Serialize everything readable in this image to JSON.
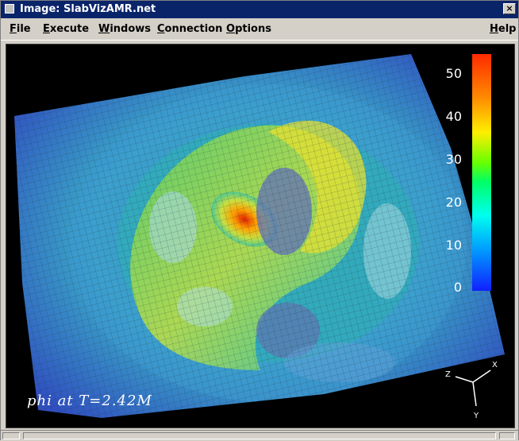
{
  "window": {
    "title": "Image: SlabVizAMR.net",
    "close_glyph": "×"
  },
  "menu": {
    "items": [
      {
        "label": "File",
        "mnemonic": "F",
        "rest": "ile"
      },
      {
        "label": "Execute",
        "mnemonic": "E",
        "rest": "xecute"
      },
      {
        "label": "Windows",
        "mnemonic": "W",
        "rest": "indows"
      },
      {
        "label": "Connection",
        "mnemonic": "C",
        "rest": "onnection"
      },
      {
        "label": "Options",
        "mnemonic": "O",
        "rest": "ptions"
      },
      {
        "label": "Help",
        "mnemonic": "H",
        "rest": "elp"
      }
    ]
  },
  "visualization": {
    "caption": "phi at T=2.42M",
    "colorbar": {
      "ticks": [
        "50",
        "40",
        "30",
        "20",
        "10",
        "0"
      ],
      "min": 0,
      "max": 55,
      "colors": [
        "#ff2a00",
        "#ffee00",
        "#00ff66",
        "#00ffee",
        "#1020ff"
      ]
    },
    "axes": {
      "x": "X",
      "y": "Y",
      "z": "Z"
    }
  }
}
